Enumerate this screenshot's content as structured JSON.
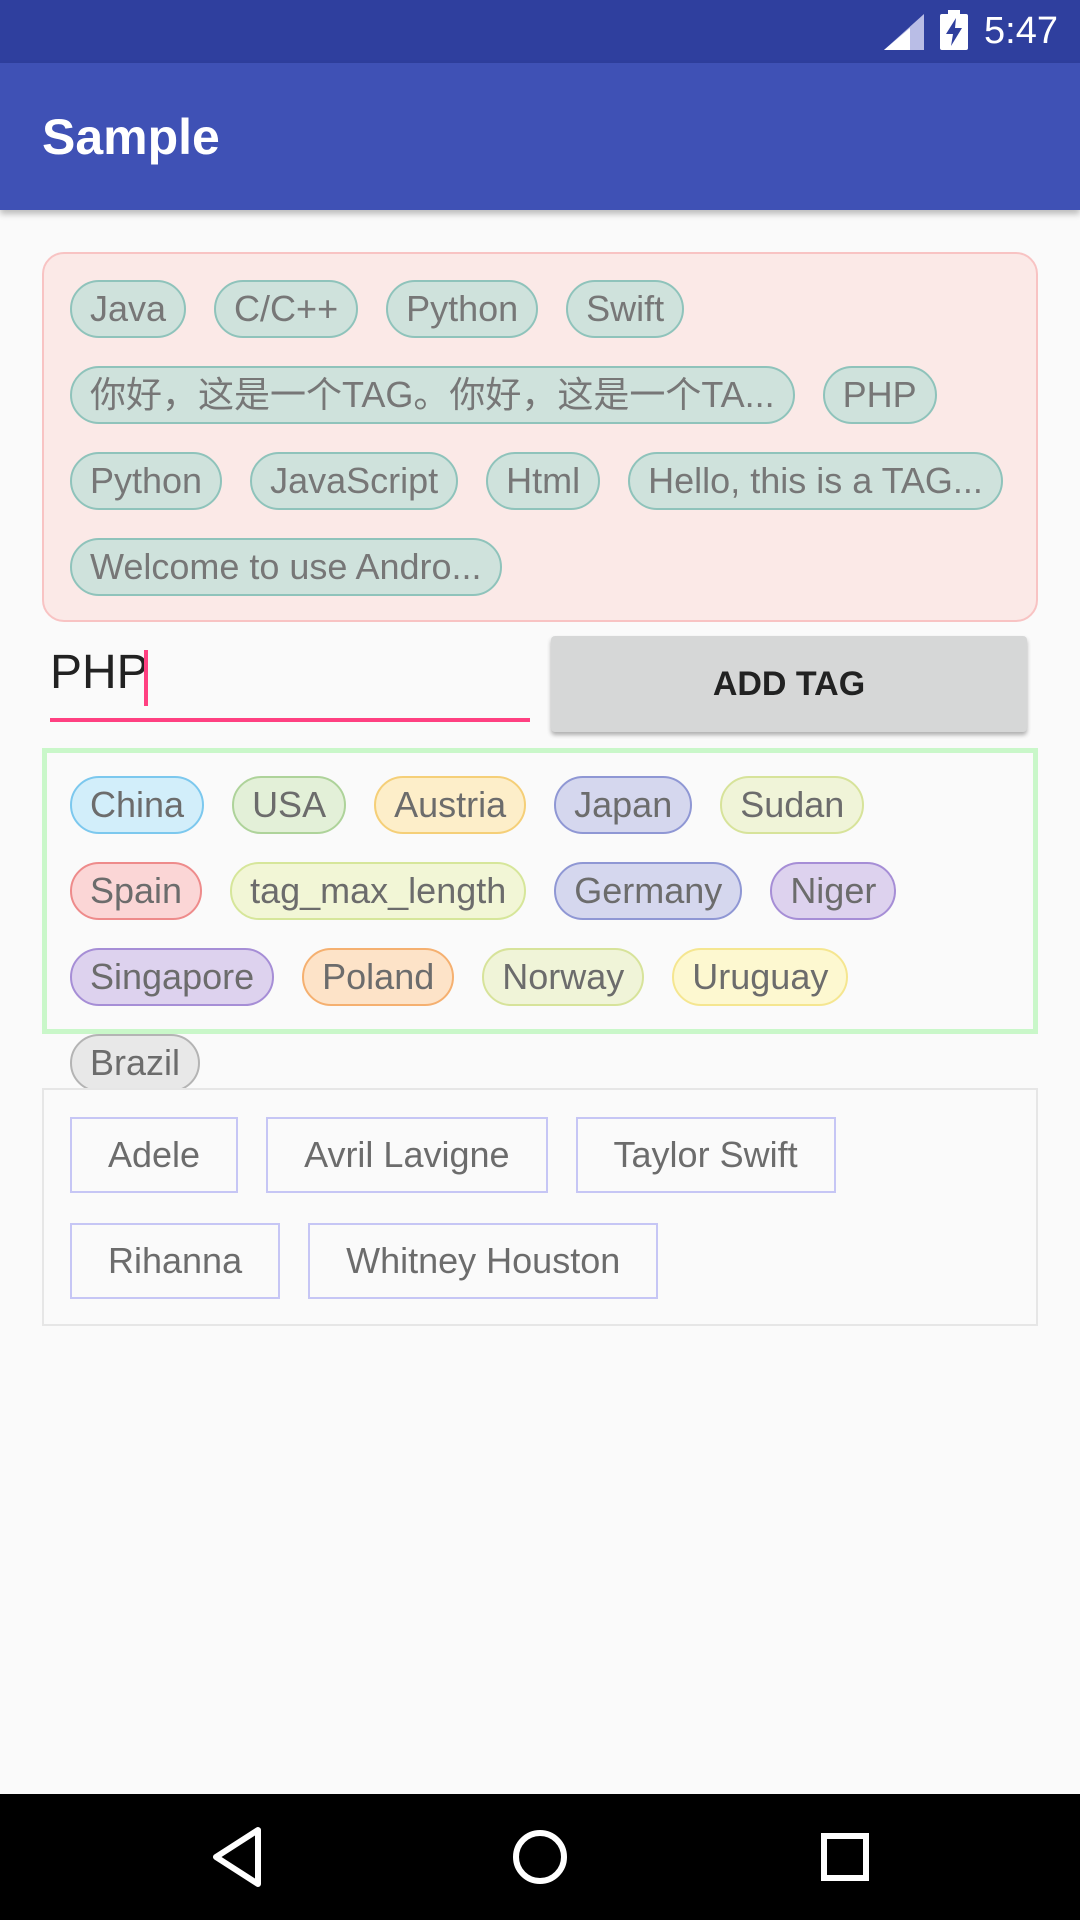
{
  "status_bar": {
    "time": "5:47"
  },
  "app_bar": {
    "title": "Sample"
  },
  "tag_group_1": {
    "tags": [
      "Java",
      "C/C++",
      "Python",
      "Swift",
      "你好，这是一个TAG。你好，这是一个TA...",
      "PHP",
      "Python",
      "JavaScript",
      "Html",
      "Hello, this is a TAG...",
      "Welcome to use Andro..."
    ]
  },
  "input": {
    "value": "PHP"
  },
  "add_button": {
    "label": "ADD TAG"
  },
  "tag_group_2": {
    "tags": [
      {
        "label": "China",
        "bg": "#d2eefa",
        "border": "#7cc8ee"
      },
      {
        "label": "USA",
        "bg": "#e3f0d8",
        "border": "#aed39a"
      },
      {
        "label": "Austria",
        "bg": "#fdeec9",
        "border": "#f5cf78"
      },
      {
        "label": "Japan",
        "bg": "#d5d7ee",
        "border": "#8f97d4"
      },
      {
        "label": "Sudan",
        "bg": "#f0f4d8",
        "border": "#d7e39a"
      },
      {
        "label": "Spain",
        "bg": "#fbd6d6",
        "border": "#ee8b8b"
      },
      {
        "label": "tag_max_length",
        "bg": "#f2f6d6",
        "border": "#d6e69a"
      },
      {
        "label": "Germany",
        "bg": "#d5d7ee",
        "border": "#8f97d4"
      },
      {
        "label": "Niger",
        "bg": "#ddd2ee",
        "border": "#a68ed6"
      },
      {
        "label": "Singapore",
        "bg": "#ddd2ee",
        "border": "#a68ed6"
      },
      {
        "label": "Poland",
        "bg": "#fde3c8",
        "border": "#f5b070"
      },
      {
        "label": "Norway",
        "bg": "#f0f4d8",
        "border": "#d7e39a"
      },
      {
        "label": "Uruguay",
        "bg": "#fdf8d0",
        "border": "#f5e690"
      },
      {
        "label": "Brazil",
        "bg": "#e8e8e8",
        "border": "#b4b4b4"
      }
    ]
  },
  "tag_group_3": {
    "tags": [
      "Adele",
      "Avril Lavigne",
      "Taylor Swift",
      "Rihanna",
      "Whitney Houston"
    ]
  }
}
